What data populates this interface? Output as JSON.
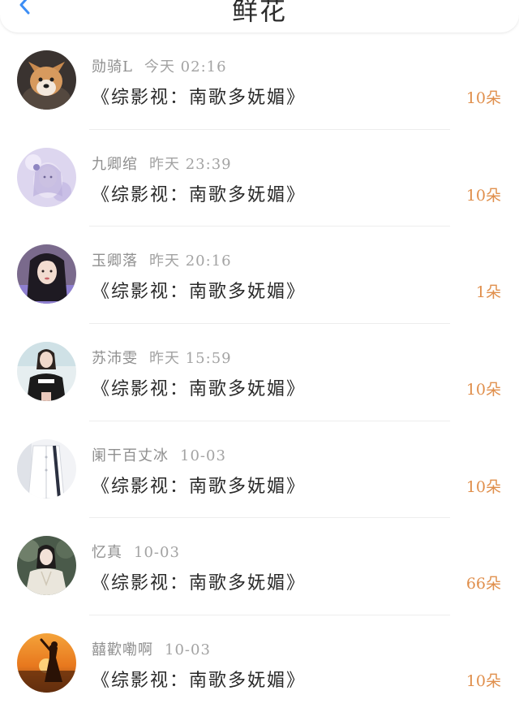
{
  "header": {
    "title": "鲜花"
  },
  "colors": {
    "count": "#e08f4c",
    "back_icon": "#3d8ef5",
    "meta": "#9a9a9a"
  },
  "rows": [
    {
      "name": "勋骑L",
      "time": "今天 02:16",
      "book": "《综影视：南歌多妩媚》",
      "count": "10朵",
      "avatar": "corgi-dog-avatar"
    },
    {
      "name": "九卿绾",
      "time": "昨天 23:39",
      "book": "《综影视：南歌多妩媚》",
      "count": "10朵",
      "avatar": "illustrated-girl-avatar"
    },
    {
      "name": "玉卿落",
      "time": "昨天 20:16",
      "book": "《综影视：南歌多妩媚》",
      "count": "1朵",
      "avatar": "woman-portrait-avatar"
    },
    {
      "name": "苏沛雯",
      "time": "昨天 15:59",
      "book": "《综影视：南歌多妩媚》",
      "count": "10朵",
      "avatar": "girl-black-tshirt-avatar"
    },
    {
      "name": "阑干百丈冰",
      "time": "10-03",
      "book": "《综影视：南歌多妩媚》",
      "count": "10朵",
      "avatar": "white-shirt-avatar"
    },
    {
      "name": "忆真",
      "time": "10-03",
      "book": "《综影视：南歌多妩媚》",
      "count": "66朵",
      "avatar": "costume-girl-avatar"
    },
    {
      "name": "囍歡嘞啊",
      "time": "10-03",
      "book": "《综影视：南歌多妩媚》",
      "count": "10朵",
      "avatar": "sunset-silhouette-avatar"
    }
  ]
}
